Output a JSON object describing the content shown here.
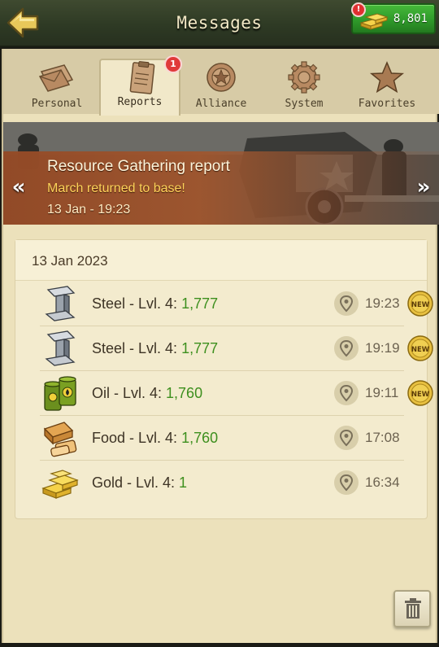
{
  "header": {
    "title": "Messages",
    "gold_amount": "8,801",
    "gold_alert": "!"
  },
  "tabs": [
    {
      "label": "Personal",
      "icon": "letter-icon"
    },
    {
      "label": "Reports",
      "icon": "clipboard-icon",
      "badge": "1"
    },
    {
      "label": "Alliance",
      "icon": "alliance-shield-icon"
    },
    {
      "label": "System",
      "icon": "gear-icon"
    },
    {
      "label": "Favorites",
      "icon": "star-icon"
    }
  ],
  "banner": {
    "title": "Resource Gathering report",
    "subtitle": "March returned to base!",
    "date": "13 Jan - 19:23"
  },
  "report": {
    "date": "13 Jan 2023",
    "items": [
      {
        "label": "Steel - Lvl. 4: ",
        "amount": "1,777",
        "time": "19:23",
        "new": true,
        "icon": "steel-beam-icon"
      },
      {
        "label": "Steel - Lvl. 4: ",
        "amount": "1,777",
        "time": "19:19",
        "new": true,
        "icon": "steel-beam-icon"
      },
      {
        "label": "Oil - Lvl. 4: ",
        "amount": "1,760",
        "time": "19:11",
        "new": true,
        "icon": "oil-barrel-icon"
      },
      {
        "label": "Food - Lvl. 4: ",
        "amount": "1,760",
        "time": "17:08",
        "new": false,
        "icon": "bread-icon"
      },
      {
        "label": "Gold - Lvl. 4: ",
        "amount": "1",
        "time": "16:34",
        "new": false,
        "icon": "gold-bars-icon"
      }
    ],
    "new_badge_text": "NEW"
  },
  "colors": {
    "accent_green": "#3d8f1e",
    "banner_subtitle": "#ffd35a",
    "badge_red": "#e03a3a"
  }
}
